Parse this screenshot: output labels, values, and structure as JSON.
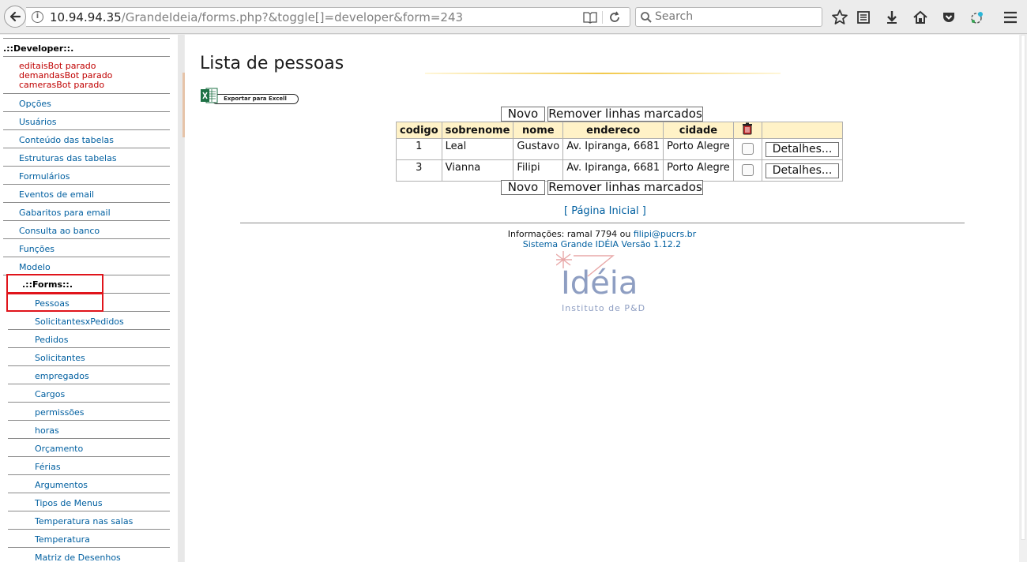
{
  "browser": {
    "url_host": "10.94.94.35",
    "url_path": "/GrandeIdeia/forms.php?&toggle[]=developer&form=243",
    "search_placeholder": "Search"
  },
  "sidebar": {
    "developer_header": ".::Developer::.",
    "bot_status": [
      "editaisBot parado",
      "demandasBot parado",
      "camerasBot parado"
    ],
    "dev_items": [
      "Opções",
      "Usuários",
      "Conteúdo das tabelas",
      "Estruturas das tabelas",
      "Formulários",
      "Eventos de email",
      "Gabaritos para email",
      "Consulta ao banco",
      "Funções",
      "Modelo"
    ],
    "forms_header": ".::Forms::.",
    "form_items": [
      "Pessoas",
      "SolicitantesxPedidos",
      "Pedidos",
      "Solicitantes",
      "empregados",
      "Cargos",
      "permissões",
      "horas",
      "Orçamento",
      "Férias",
      "Argumentos",
      "Tipos de Menus",
      "Temperatura nas salas",
      "Temperatura",
      "Matriz de Desenhos"
    ]
  },
  "main": {
    "title": "Lista de pessoas",
    "export_label": "Exportar para Excell",
    "new_label": "Novo",
    "remove_label": "Remover linhas marcados",
    "table": {
      "headers": [
        "codigo",
        "sobrenome",
        "nome",
        "endereco",
        "cidade"
      ],
      "details_label": "Detalhes...",
      "rows": [
        {
          "codigo": "1",
          "sobrenome": "Leal",
          "nome": "Gustavo",
          "endereco": "Av. Ipiranga, 6681",
          "cidade": "Porto Alegre"
        },
        {
          "codigo": "3",
          "sobrenome": "Vianna",
          "nome": "Filipi",
          "endereco": "Av. Ipiranga, 6681",
          "cidade": "Porto Alegre"
        }
      ]
    },
    "home_link": "[ Página Inicial ]",
    "footer": {
      "info_prefix": "Informações: ramal 7794 ou",
      "email": "filipi@pucrs.br",
      "system": "Sistema Grande IDÉIA Versão 1.12.2"
    },
    "logo_text": "Idéia",
    "logo_sub": "Instituto de P&D"
  },
  "colors": {
    "link": "#005fa0",
    "status_red": "#c00000",
    "highlight": "#e0141b",
    "table_header": "#fff2c7"
  }
}
